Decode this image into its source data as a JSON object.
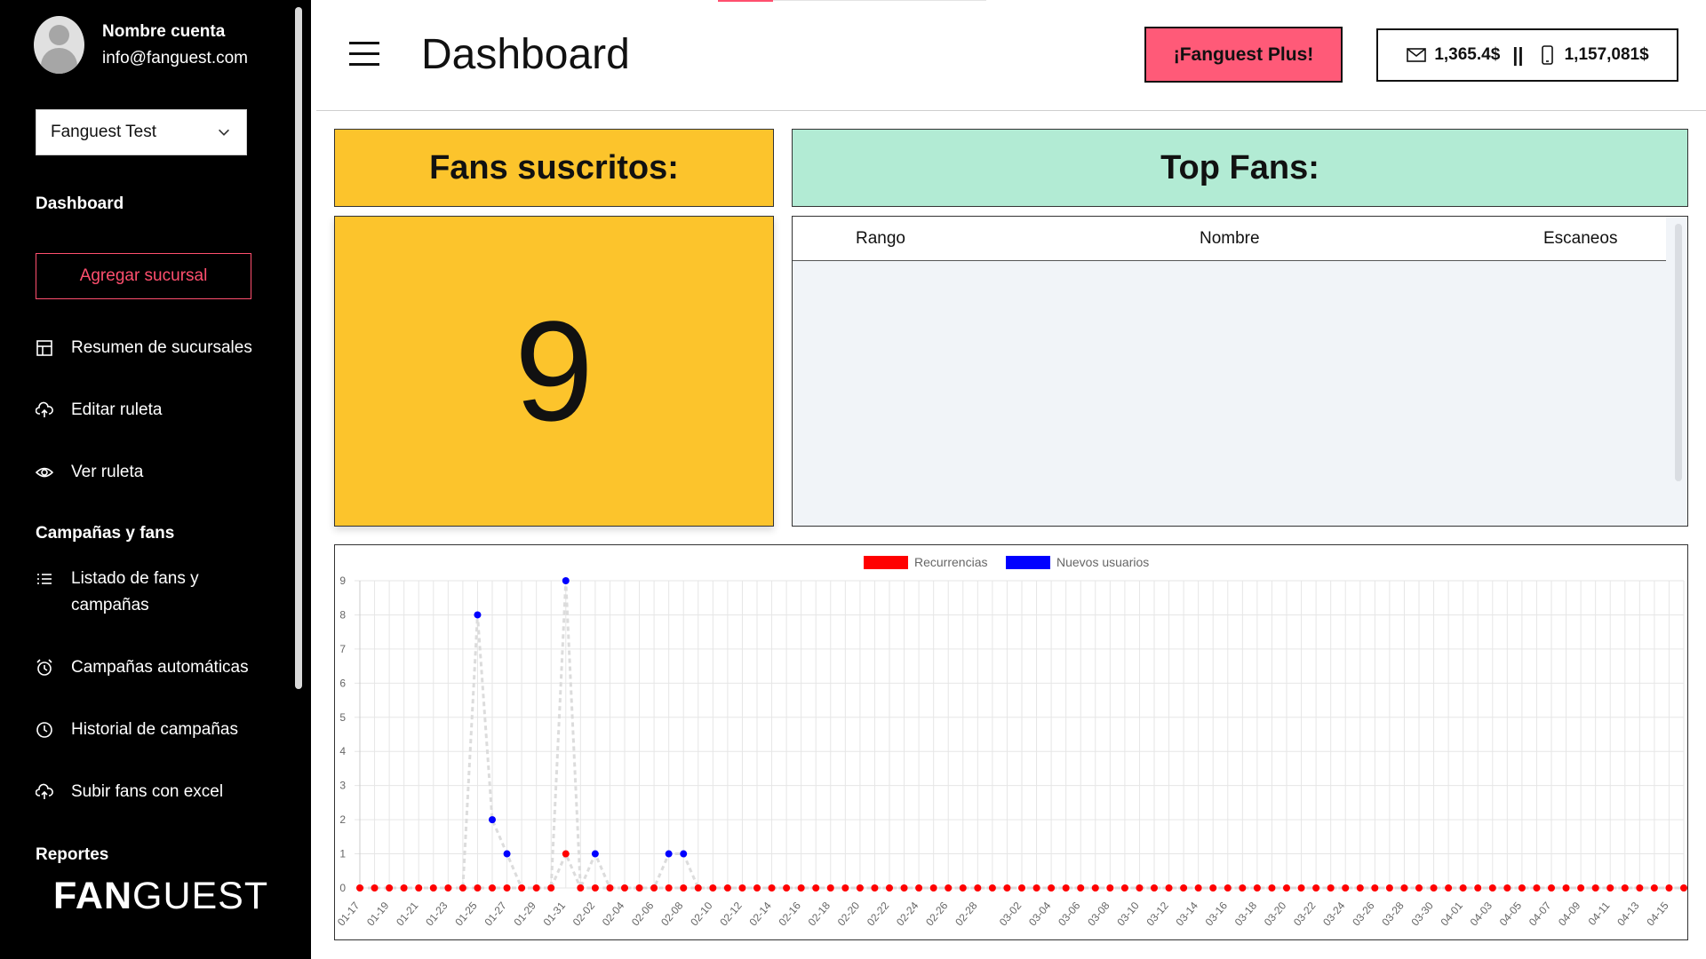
{
  "sidebar": {
    "account_name": "Nombre cuenta",
    "account_email": "info@fanguest.com",
    "branch_selected": "Fanguest Test",
    "section_dashboard": "Dashboard",
    "add_branch_label": "Agregar sucursal",
    "items_top": [
      {
        "label": "Resumen de sucursales",
        "icon": "layout-icon"
      },
      {
        "label": "Editar ruleta",
        "icon": "cloud-upload-icon"
      },
      {
        "label": "Ver ruleta",
        "icon": "eye-icon"
      }
    ],
    "section_campaigns": "Campañas y fans",
    "items_campaigns": [
      {
        "label": "Listado de fans y campañas",
        "icon": "list-icon"
      },
      {
        "label": "Campañas automáticas",
        "icon": "alarm-clock-icon"
      },
      {
        "label": "Historial de campañas",
        "icon": "clock-icon"
      },
      {
        "label": "Subir fans con excel",
        "icon": "cloud-upload-icon"
      }
    ],
    "section_reports": "Reportes",
    "brand_bold": "FAN",
    "brand_light": "GUEST"
  },
  "header": {
    "title": "Dashboard",
    "plus_button": "¡Fanguest Plus!",
    "email_balance": "1,365.4$",
    "separator": "||",
    "phone_balance": "1,157,081$"
  },
  "subscribed": {
    "title": "Fans suscritos:",
    "count": "9"
  },
  "top_fans": {
    "title": "Top Fans:",
    "columns": [
      "Rango",
      "Nombre",
      "Escaneos"
    ],
    "rows": []
  },
  "chart_data": {
    "type": "line",
    "legend": [
      "Recurrencias",
      "Nuevos usuarios"
    ],
    "colors": {
      "Recurrencias": "#ff0000",
      "Nuevos usuarios": "#0000ff"
    },
    "ylim": [
      0,
      9
    ],
    "y_ticks": [
      0,
      1,
      2,
      3,
      4,
      5,
      6,
      7,
      8,
      9
    ],
    "x_tick_labels": [
      "01-17",
      "01-19",
      "01-21",
      "01-23",
      "01-25",
      "01-27",
      "01-29",
      "01-31",
      "02-02",
      "02-04",
      "02-06",
      "02-08",
      "02-10",
      "02-12",
      "02-14",
      "02-16",
      "02-18",
      "02-20",
      "02-22",
      "02-24",
      "02-26",
      "02-28",
      "03-02",
      "03-04",
      "03-06",
      "03-08",
      "03-10",
      "03-12",
      "03-14",
      "03-16",
      "03-18",
      "03-20",
      "03-22",
      "03-24",
      "03-26",
      "03-28",
      "03-30",
      "04-01",
      "04-03",
      "04-05",
      "04-07",
      "04-09",
      "04-11",
      "04-13",
      "04-15"
    ],
    "grid": true,
    "legend_position": "top",
    "start_date": "01-17",
    "num_points": 91,
    "series": [
      {
        "name": "Nuevos usuarios",
        "points": {
          "01-25": 8,
          "01-26": 2,
          "01-27": 1,
          "01-31": 9,
          "02-02": 1,
          "02-07": 1,
          "02-08": 1
        }
      },
      {
        "name": "Recurrencias",
        "points": {
          "01-31": 1
        }
      }
    ]
  }
}
